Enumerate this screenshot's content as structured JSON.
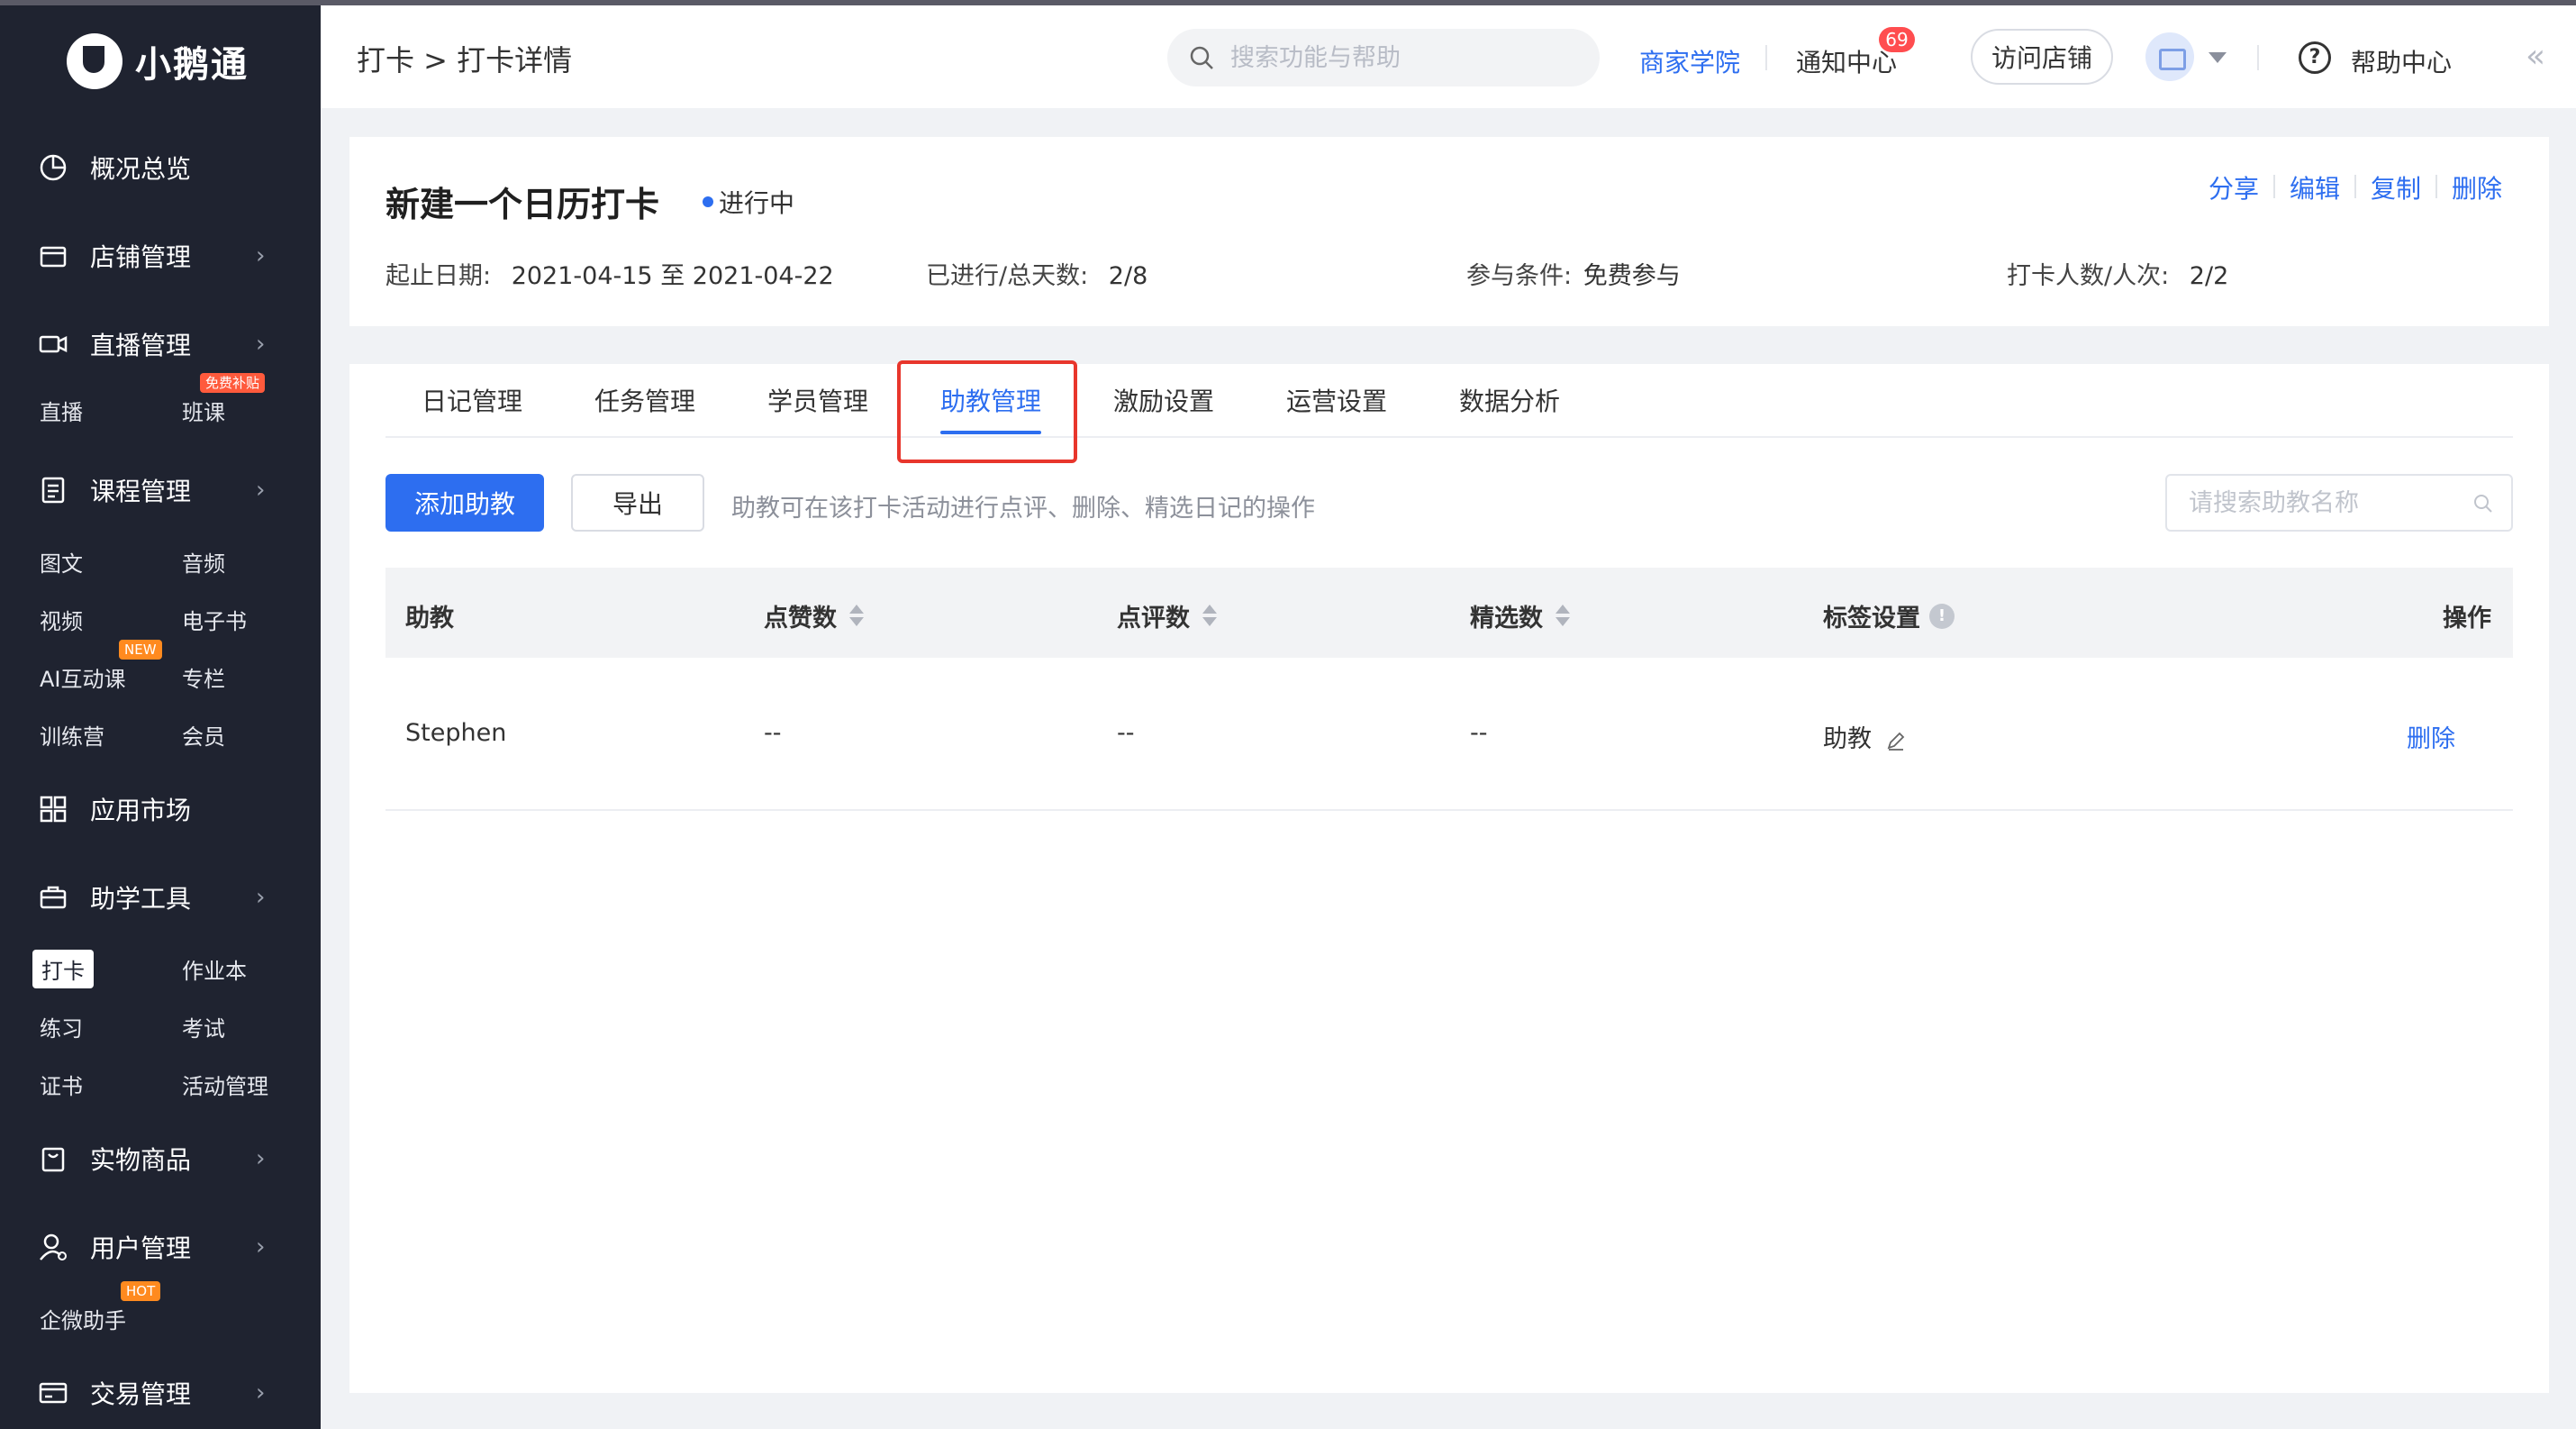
{
  "app": {
    "brand": "小鹅通"
  },
  "sidebar": {
    "groups": [
      {
        "label": "概况总览",
        "icon": "dashboard-icon",
        "has_arrow": false
      },
      {
        "label": "店铺管理",
        "icon": "shop-icon",
        "has_arrow": true
      },
      {
        "label": "直播管理",
        "icon": "video-camera-icon",
        "has_arrow": true,
        "items": [
          {
            "label": "直播"
          },
          {
            "label": "班课",
            "badge": "免费补贴"
          }
        ]
      },
      {
        "label": "课程管理",
        "icon": "document-icon",
        "has_arrow": true,
        "items": [
          {
            "label": "图文"
          },
          {
            "label": "音频"
          },
          {
            "label": "视频"
          },
          {
            "label": "电子书"
          },
          {
            "label": "AI互动课",
            "badge": "NEW"
          },
          {
            "label": "专栏"
          },
          {
            "label": "训练营"
          },
          {
            "label": "会员"
          }
        ]
      },
      {
        "label": "应用市场",
        "icon": "apps-grid-icon",
        "has_arrow": false
      },
      {
        "label": "助学工具",
        "icon": "toolbox-icon",
        "has_arrow": true,
        "items": [
          {
            "label": "打卡",
            "active": true
          },
          {
            "label": "作业本"
          },
          {
            "label": "练习"
          },
          {
            "label": "考试"
          },
          {
            "label": "证书"
          },
          {
            "label": "活动管理"
          }
        ]
      },
      {
        "label": "实物商品",
        "icon": "shopping-bag-icon",
        "has_arrow": true
      },
      {
        "label": "用户管理",
        "icon": "user-icon",
        "has_arrow": true,
        "items": [
          {
            "label": "企微助手",
            "badge": "HOT"
          }
        ]
      },
      {
        "label": "交易管理",
        "icon": "wallet-icon",
        "has_arrow": true
      }
    ]
  },
  "header": {
    "breadcrumb": "打卡 > 打卡详情",
    "search_placeholder": "搜索功能与帮助",
    "academy": "商家学院",
    "notify": "通知中心",
    "notify_count": "69",
    "visit_store": "访问店铺",
    "help": "帮助中心"
  },
  "activity": {
    "title": "新建一个日历打卡",
    "status": "进行中",
    "actions": {
      "share": "分享",
      "edit": "编辑",
      "copy": "复制",
      "delete": "删除"
    },
    "date_label": "起止日期:",
    "date_value": "2021-04-15 至 2021-04-22",
    "progress_label": "已进行/总天数:",
    "progress_value": "2/8",
    "condition_label": "参与条件:",
    "condition_value": "免费参与",
    "count_label": "打卡人数/人次:",
    "count_value": "2/2"
  },
  "tabs": [
    "日记管理",
    "任务管理",
    "学员管理",
    "助教管理",
    "激励设置",
    "运营设置",
    "数据分析"
  ],
  "active_tab": "助教管理",
  "toolbar": {
    "add_button": "添加助教",
    "export_button": "导出",
    "hint": "助教可在该打卡活动进行点评、删除、精选日记的操作",
    "search_placeholder": "请搜索助教名称"
  },
  "table": {
    "columns": [
      "助教",
      "点赞数",
      "点评数",
      "精选数",
      "标签设置",
      "操作"
    ],
    "rows": [
      {
        "name": "Stephen",
        "likes": "--",
        "comments": "--",
        "featured": "--",
        "tag": "助教",
        "action": "删除"
      }
    ]
  },
  "colors": {
    "accent": "#2d6ef0",
    "sidebar_bg": "#1f2330",
    "highlight": "#e8362c",
    "badge": "#ff4d4f"
  }
}
